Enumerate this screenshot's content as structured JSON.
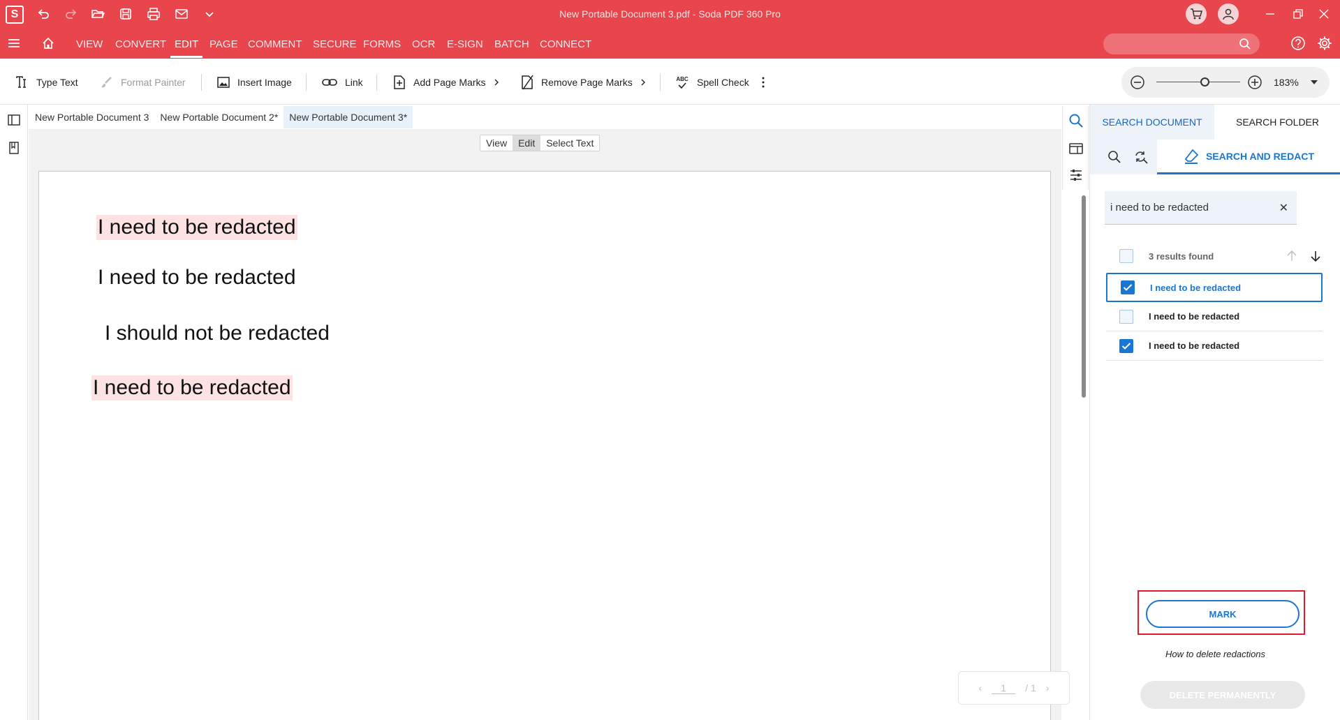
{
  "window": {
    "logo": "S",
    "title": "New Portable Document 3.pdf  -  Soda PDF 360 Pro"
  },
  "menu": {
    "items": [
      "VIEW",
      "CONVERT",
      "EDIT",
      "PAGE",
      "COMMENT",
      "SECURE",
      "FORMS",
      "OCR",
      "E-SIGN",
      "BATCH",
      "CONNECT"
    ],
    "active": "EDIT",
    "search_placeholder": ""
  },
  "toolbar": {
    "type_text": "Type Text",
    "format_painter": "Format Painter",
    "insert_image": "Insert Image",
    "link": "Link",
    "add_page_marks": "Add Page Marks",
    "remove_page_marks": "Remove Page Marks",
    "spell_check": "Spell Check",
    "spell_check_icon_text": "ABC",
    "zoom": "183%"
  },
  "doc_tabs": [
    "New Portable Document 3",
    "New Portable Document 2*",
    "New Portable Document 3*"
  ],
  "mode_switch": [
    "View",
    "Edit",
    "Select Text"
  ],
  "document": {
    "lines": [
      {
        "text": "I need to be redacted",
        "highlighted": true
      },
      {
        "text": "I need to be redacted",
        "highlighted": false
      },
      {
        "text": "I should not be redacted",
        "highlighted": false
      },
      {
        "text": "I need to be redacted",
        "highlighted": true
      }
    ]
  },
  "pager": {
    "current": "1",
    "total": "/ 1"
  },
  "panel": {
    "tab_search_document": "SEARCH DOCUMENT",
    "tab_search_folder": "SEARCH FOLDER",
    "subtab_redact": "SEARCH AND REDACT",
    "search_value": "i need to be redacted",
    "results_count": "3 results found",
    "results": [
      {
        "text": "I need to be redacted",
        "checked": true,
        "selected": true
      },
      {
        "text": "I need to be redacted",
        "checked": false,
        "selected": false
      },
      {
        "text": "I need to be redacted",
        "checked": true,
        "selected": false
      }
    ],
    "mark_button": "MARK",
    "how_to_link": "How to delete redactions",
    "delete_button": "DELETE PERMANENTLY"
  },
  "colors": {
    "brand": "#e8454d",
    "accent": "#1976d2",
    "highlight": "#fde2e3",
    "mark_outline": "#e5172b"
  }
}
